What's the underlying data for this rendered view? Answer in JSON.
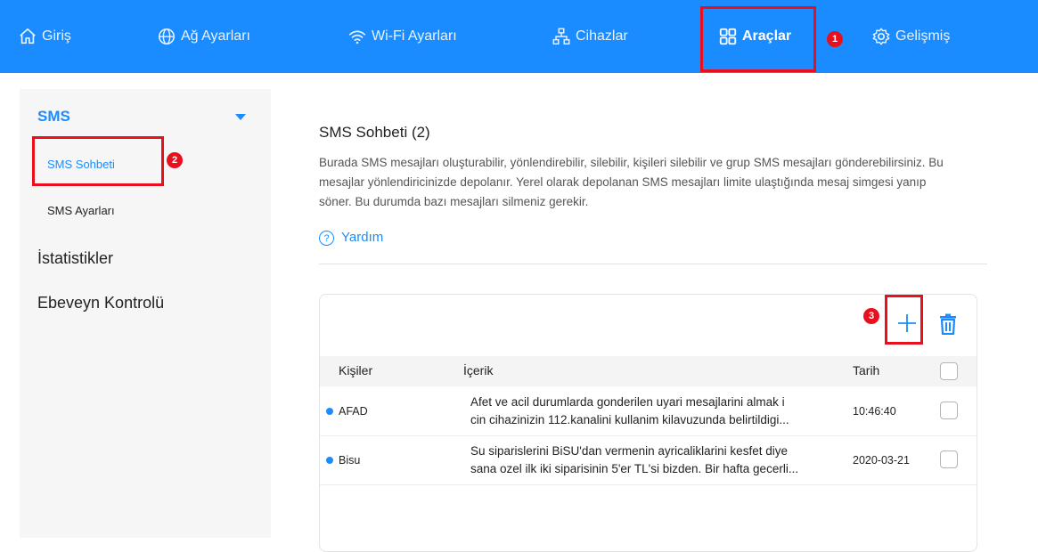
{
  "nav": {
    "home": "Giriş",
    "network": "Ağ Ayarları",
    "wifi": "Wi-Fi Ayarları",
    "devices": "Cihazlar",
    "tools": "Araçlar",
    "advanced": "Gelişmiş"
  },
  "annotations": {
    "one": "1",
    "two": "2",
    "three": "3"
  },
  "sidebar": {
    "sms": "SMS",
    "sms_chat": "SMS Sohbeti",
    "sms_settings": "SMS Ayarları",
    "statistics": "İstatistikler",
    "parental": "Ebeveyn Kontrolü"
  },
  "main": {
    "title": "SMS Sohbeti (2)",
    "description": "Burada SMS mesajları oluşturabilir, yönlendirebilir, silebilir, kişileri silebilir ve grup SMS mesajları gönderebilirsiniz. Bu mesajlar yönlendiricinizde depolanır. Yerel olarak depolanan SMS mesajları limite ulaştığında mesaj simgesi yanıp söner. Bu durumda bazı mesajları silmeniz gerekir.",
    "help": "Yardım",
    "help_icon": "?"
  },
  "table": {
    "headers": {
      "contacts": "Kişiler",
      "content": "İçerik",
      "date": "Tarih"
    },
    "rows": [
      {
        "contact": "AFAD",
        "line1": "Afet ve acil durumlarda gonderilen uyari mesajlarini almak i",
        "line2": "cin cihazinizin 112.kanalini kullanim kilavuzunda belirtildigi...",
        "date": "10:46:40"
      },
      {
        "contact": "Bisu",
        "line1": "Su siparislerini BiSU'dan vermenin ayricaliklarini kesfet diye",
        "line2": "sana ozel ilk iki siparisinin 5'er TL'si bizden. Bir hafta gecerli...",
        "date": "2020-03-21"
      }
    ]
  },
  "colors": {
    "accent": "#1a8cff",
    "highlight": "#e8101d"
  }
}
